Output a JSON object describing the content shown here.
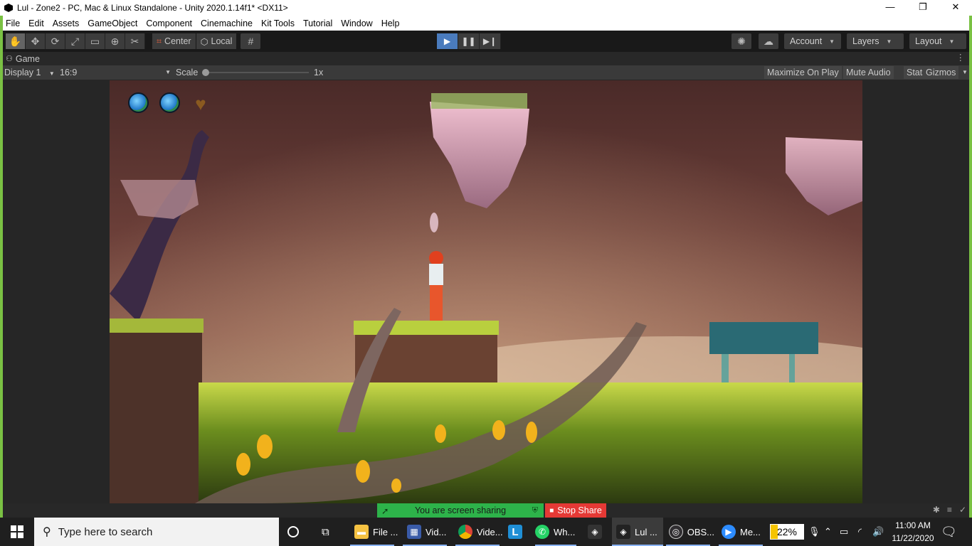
{
  "window": {
    "title": "Lul - Zone2 - PC, Mac & Linux Standalone - Unity 2020.1.14f1* <DX11>",
    "controls": [
      "—",
      "❐",
      "✕"
    ]
  },
  "menu": [
    "File",
    "Edit",
    "Assets",
    "GameObject",
    "Component",
    "Cinemachine",
    "Kit Tools",
    "Tutorial",
    "Window",
    "Help"
  ],
  "toolbar": {
    "pivot_label": "Center",
    "space_label": "Local",
    "account_label": "Account",
    "layers_label": "Layers",
    "layout_label": "Layout"
  },
  "game_tab": {
    "title": "Game",
    "display": "Display 1",
    "aspect": "16:9",
    "scale_label": "Scale",
    "scale_value": "1x",
    "buttons": [
      "Maximize On Play",
      "Mute Audio",
      "Stats",
      "Gizmos"
    ]
  },
  "share": {
    "status": "You are screen sharing",
    "stop_label": "Stop Share"
  },
  "taskbar": {
    "search_placeholder": "Type here to search",
    "apps": [
      "File ...",
      "Vid...",
      "Vide...",
      "Wh...",
      "Lul ...",
      "OBS...",
      "Me..."
    ],
    "battery_percent": "22%",
    "time": "11:00 AM",
    "date": "11/22/2020"
  },
  "colors": {
    "accent_green": "#7ac143",
    "play_blue": "#4a7bbd",
    "share_green": "#2db34a",
    "stop_red": "#e53935",
    "battery_yellow": "#f5c400"
  },
  "battery_level": 0.22
}
